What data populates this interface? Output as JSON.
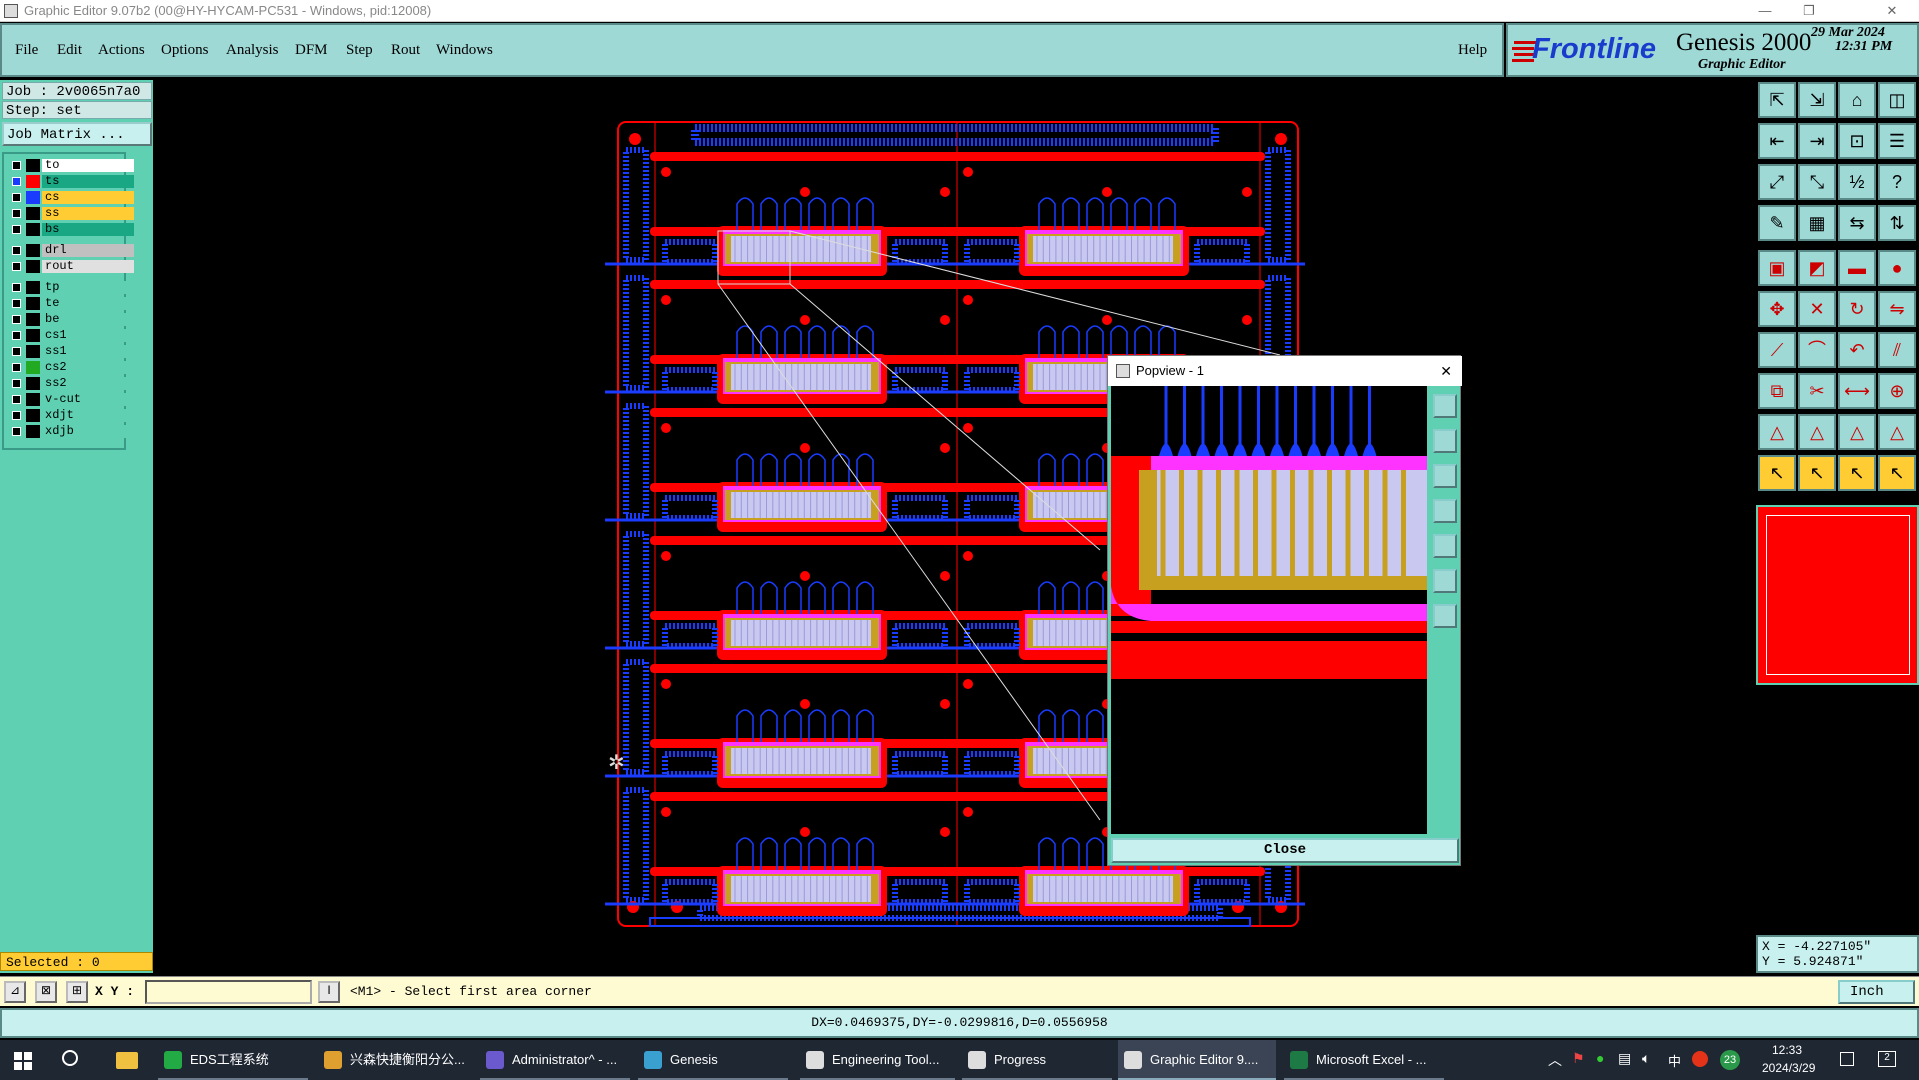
{
  "window": {
    "title": "Graphic Editor 9.07b2 (00@HY-HYCAM-PC531 - Windows, pid:12008)"
  },
  "menu": {
    "items": [
      "File",
      "Edit",
      "Actions",
      "Options",
      "Analysis",
      "DFM",
      "Step",
      "Rout",
      "Windows"
    ],
    "help": "Help"
  },
  "brand": {
    "company": "Frontline",
    "product": "Genesis 2000",
    "subtitle": "Graphic Editor",
    "date": "29 Mar 2024",
    "time": "12:31 PM"
  },
  "job": {
    "job_line": "Job : 2v0065n7a0",
    "step_line": "Step: set",
    "matrix_button": "Job Matrix ..."
  },
  "layers": [
    {
      "name": "to",
      "swatch": "#000000",
      "bg": "#ffffff",
      "text": "#000000",
      "check": "#000000"
    },
    {
      "name": "ts",
      "swatch": "#ff0000",
      "bg": "#1aa884",
      "text": "#000000",
      "check": "#1a3cff",
      "extra": "="
    },
    {
      "name": "cs",
      "swatch": "#1a3cff",
      "bg": "#ffcc33",
      "text": "#000000",
      "check": "#000000"
    },
    {
      "name": "ss",
      "swatch": "#000000",
      "bg": "#ffcc33",
      "text": "#000000",
      "check": "#000000"
    },
    {
      "name": "bs",
      "swatch": "#000000",
      "bg": "#1aa884",
      "text": "#000000",
      "check": "#000000"
    },
    {
      "name": "drl",
      "swatch": "#000000",
      "bg": "#c0c0c0",
      "text": "#000000",
      "check": "#000000",
      "gap": true
    },
    {
      "name": "rout",
      "swatch": "#000000",
      "bg": "#e0e0e0",
      "text": "#000000",
      "check": "#000000"
    },
    {
      "name": "tp",
      "swatch": "#000000",
      "bg": "#5fd0b2",
      "text": "#000000",
      "check": "#000000",
      "gap": true
    },
    {
      "name": "te",
      "swatch": "#000000",
      "bg": "#5fd0b2",
      "text": "#000000",
      "check": "#000000"
    },
    {
      "name": "be",
      "swatch": "#000000",
      "bg": "#5fd0b2",
      "text": "#000000",
      "check": "#000000"
    },
    {
      "name": "cs1",
      "swatch": "#000000",
      "bg": "#5fd0b2",
      "text": "#000000",
      "check": "#000000"
    },
    {
      "name": "ss1",
      "swatch": "#000000",
      "bg": "#5fd0b2",
      "text": "#000000",
      "check": "#000000"
    },
    {
      "name": "cs2",
      "swatch": "#22aa22",
      "bg": "#5fd0b2",
      "text": "#000000",
      "check": "#000000"
    },
    {
      "name": "ss2",
      "swatch": "#000000",
      "bg": "#5fd0b2",
      "text": "#000000",
      "check": "#000000"
    },
    {
      "name": "v-cut",
      "swatch": "#000000",
      "bg": "#5fd0b2",
      "text": "#000000",
      "check": "#000000"
    },
    {
      "name": "xdjt",
      "swatch": "#000000",
      "bg": "#5fd0b2",
      "text": "#000000",
      "check": "#000000"
    },
    {
      "name": "xdjb",
      "swatch": "#000000",
      "bg": "#5fd0b2",
      "text": "#000000",
      "check": "#000000"
    }
  ],
  "selected": "Selected : 0",
  "popview": {
    "title": "Popview - 1",
    "close_x": "✕",
    "close_button": "Close"
  },
  "coords": {
    "x": "X = -4.227105\"",
    "y": "Y =  5.924871\""
  },
  "command": {
    "xy_label": "X Y :",
    "input_value": "",
    "prompt": "<M1> - Select first area corner",
    "units": "Inch"
  },
  "status": {
    "text": "DX=0.0469375,DY=-0.0299816,D=0.0556958"
  },
  "taskbar": {
    "tasks": [
      {
        "label": "EDS工程系统",
        "color": "#22aa44",
        "state": "open"
      },
      {
        "label": "兴森快捷衡阳分公...",
        "color": "#e0a030",
        "state": ""
      },
      {
        "label": "Administrator^ - ...",
        "color": "#6a5acd",
        "state": "open"
      },
      {
        "label": "Genesis",
        "color": "#3aa0d0",
        "state": "open"
      },
      {
        "label": "Engineering Tool...",
        "color": "#dddddd",
        "state": "open"
      },
      {
        "label": "Progress",
        "color": "#dddddd",
        "state": "open"
      },
      {
        "label": "Graphic Editor 9....",
        "color": "#dddddd",
        "state": "active"
      },
      {
        "label": "Microsoft Excel - ...",
        "color": "#1e7a45",
        "state": "open"
      }
    ],
    "clock_time": "12:33",
    "clock_date": "2024/3/29",
    "ime": "中",
    "notify_count": "23",
    "action_count": "2"
  },
  "colors": {
    "pad": "#ff0000",
    "line": "#1a3cff",
    "panel": "#5fd0b2",
    "menu": "#9ed9d6",
    "gold": "#c8a020",
    "lilac": "#c8c8f0",
    "magenta": "#ff33ff"
  }
}
